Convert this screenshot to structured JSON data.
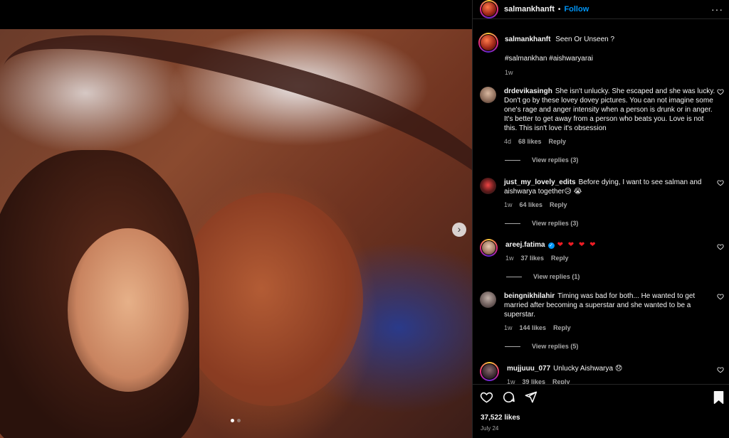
{
  "post": {
    "username": "salmankhanft",
    "follow_label": "Follow",
    "separator": "•",
    "more_label": "···",
    "caption_text": "Seen Or Unseen ?",
    "hashtags": "#salmankhan #aishwaryarai",
    "caption_time": "1w",
    "likes": "37,522 likes",
    "date": "July 24",
    "carousel_next": "›"
  },
  "comments": [
    {
      "username": "drdevikasingh",
      "text": "She isn't unlucky. She escaped and she was lucky. Don't go by these lovey dovey pictures. You can not imagine some one's rage and anger intensity when a person is drunk or in anger. It's better to get away from a person who beats you. Love is not this. This isn't love it's obsession",
      "time": "4d",
      "likes": "68 likes",
      "reply": "Reply",
      "view_replies": "View replies (3)"
    },
    {
      "username": "just_my_lovely_edits",
      "text": "Before dying, I want to see salman and aishwarya together😥 😭",
      "time": "1w",
      "likes": "64 likes",
      "reply": "Reply",
      "view_replies": "View replies (3)"
    },
    {
      "username": "areej.fatima",
      "verified_mark": "✓",
      "text": "❤ ❤ ❤ ❤",
      "time": "1w",
      "likes": "37 likes",
      "reply": "Reply",
      "view_replies": "View replies (1)"
    },
    {
      "username": "beingnikhilahir",
      "text": "Timing was bad for both... He wanted to get married after becoming a superstar and she wanted to be a superstar.",
      "time": "1w",
      "likes": "144 likes",
      "reply": "Reply",
      "view_replies": "View replies (5)"
    },
    {
      "username": "mujjuuu_077",
      "text": "Unlucky Aishwarya 😞",
      "time": "1w",
      "likes": "39 likes",
      "reply": "Reply"
    }
  ],
  "colors": {
    "accent": "#0095f6",
    "secondary_text": "#a8a8a8",
    "heart_emoji": "#ed1c24"
  },
  "icons": [
    "heart-icon",
    "comment-icon",
    "share-icon",
    "bookmark-icon",
    "more-options-icon",
    "chevron-right-icon"
  ]
}
